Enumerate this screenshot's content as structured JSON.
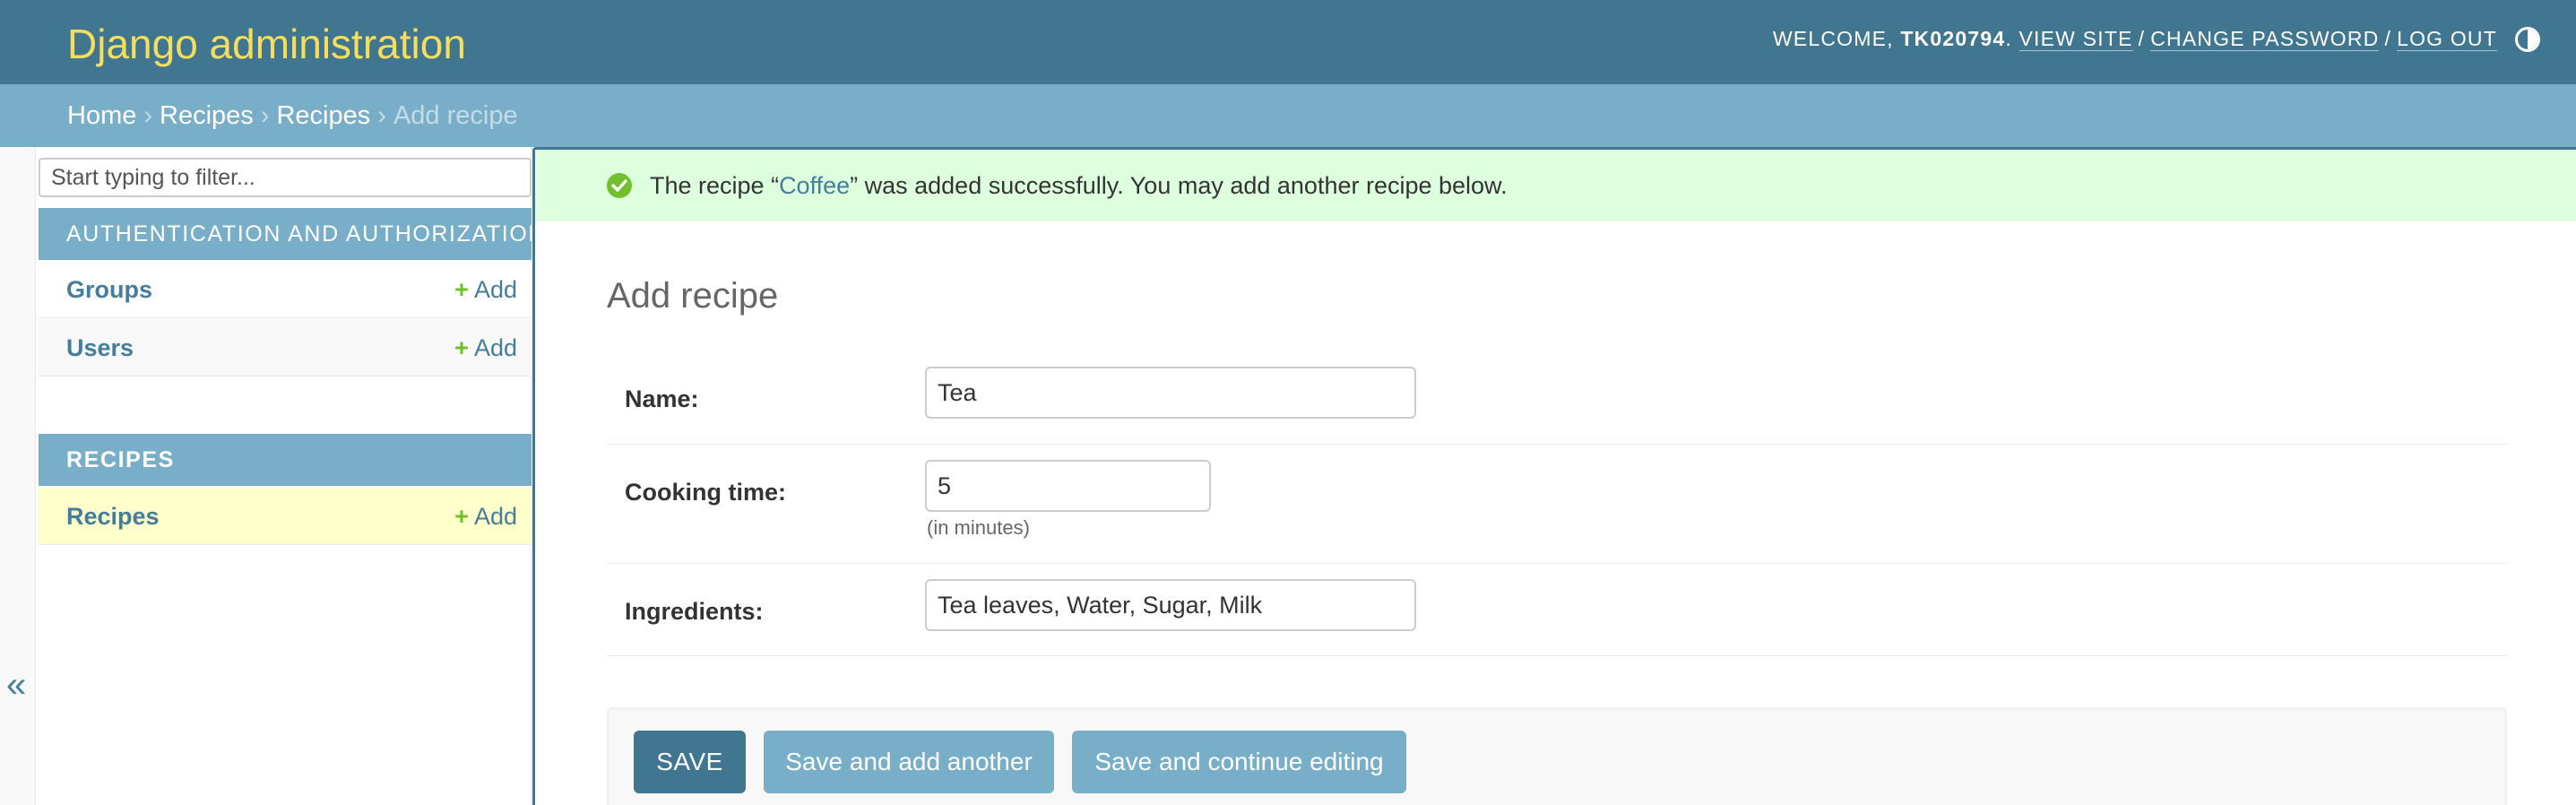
{
  "header": {
    "brand": "Django administration",
    "welcome_label": "WELCOME, ",
    "username": "TK020794",
    "username_suffix": ".",
    "view_site": "VIEW SITE",
    "sep1": "/",
    "change_password": "CHANGE PASSWORD",
    "sep2": "/",
    "log_out": "LOG OUT",
    "theme_toggle_icon": "half-circle-icon"
  },
  "breadcrumbs": {
    "items": [
      "Home",
      "Recipes",
      "Recipes"
    ],
    "separator": "›",
    "current": "Add recipe"
  },
  "sidebar": {
    "collapse_label": "«",
    "filter_placeholder": "Start typing to filter...",
    "modules": [
      {
        "caption": "Authentication and Authorization",
        "models": [
          {
            "label": "Groups",
            "add_label": "Add"
          },
          {
            "label": "Users",
            "add_label": "Add"
          }
        ]
      },
      {
        "caption": "Recipes",
        "models": [
          {
            "label": "Recipes",
            "add_label": "Add"
          }
        ]
      }
    ],
    "add_icon": "+"
  },
  "message": {
    "icon": "check-circle-icon",
    "prefix": "The recipe “",
    "link": "Coffee",
    "suffix": "” was added successfully. You may add another recipe below."
  },
  "main": {
    "title": "Add recipe",
    "fields": {
      "name": {
        "label": "Name:",
        "value": "Tea"
      },
      "cooking_time": {
        "label": "Cooking time:",
        "value": "5",
        "help": "(in minutes)"
      },
      "ingredients": {
        "label": "Ingredients:",
        "value": "Tea leaves, Water, Sugar, Milk"
      }
    },
    "buttons": {
      "save": "SAVE",
      "save_add_another": "Save and add another",
      "save_continue": "Save and continue editing"
    }
  },
  "colors": {
    "header_bg": "#417690",
    "brand": "#f5dd5d",
    "breadcrumbs_bg": "#79aec8",
    "success_bg": "#ddffdd",
    "link": "#447e9b",
    "add_green": "#70bf2b",
    "current_model_bg": "#ffffcc"
  }
}
